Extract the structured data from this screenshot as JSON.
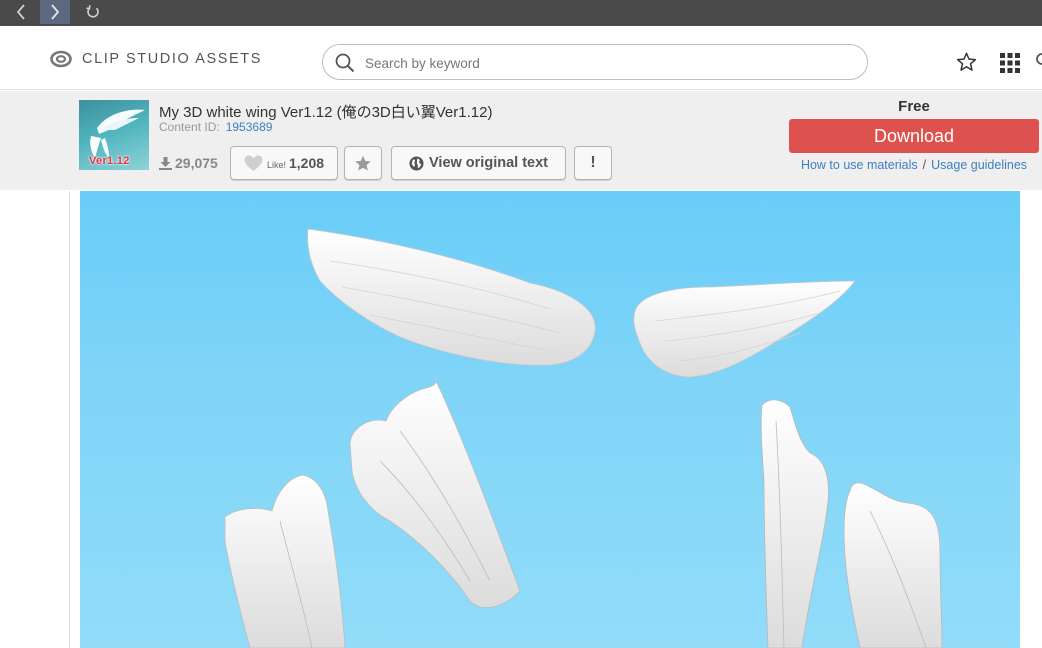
{
  "browser": {
    "icons": [
      "back-arrow-icon",
      "forward-arrow-icon",
      "reload-icon"
    ]
  },
  "header": {
    "logo_text": "CLIP STUDIO ASSETS",
    "search_placeholder": "Search by keyword",
    "search_value": "",
    "icons": [
      "clip-studio-logo-icon",
      "search-icon",
      "star-outline-icon",
      "app-grid-icon"
    ]
  },
  "asset": {
    "title": "My 3D white wing Ver1.12 (俺の3D白い翼Ver1.12)",
    "content_id_label": "Content ID:",
    "content_id": "1953689",
    "thumbnail_text": "Ver1.12",
    "downloads": "29,075",
    "like_label": "Like!",
    "like_count": "1,208",
    "view_original_label": "View original text",
    "report_label": "!",
    "price": "Free",
    "download_label": "Download",
    "how_to_use": "How to use materials",
    "separator": "/",
    "usage_guidelines": "Usage guidelines"
  },
  "colors": {
    "download_button": "#dd524f",
    "link": "#3d7fc1",
    "info_bar": "#efefef",
    "sky": "#7fd4f8"
  }
}
